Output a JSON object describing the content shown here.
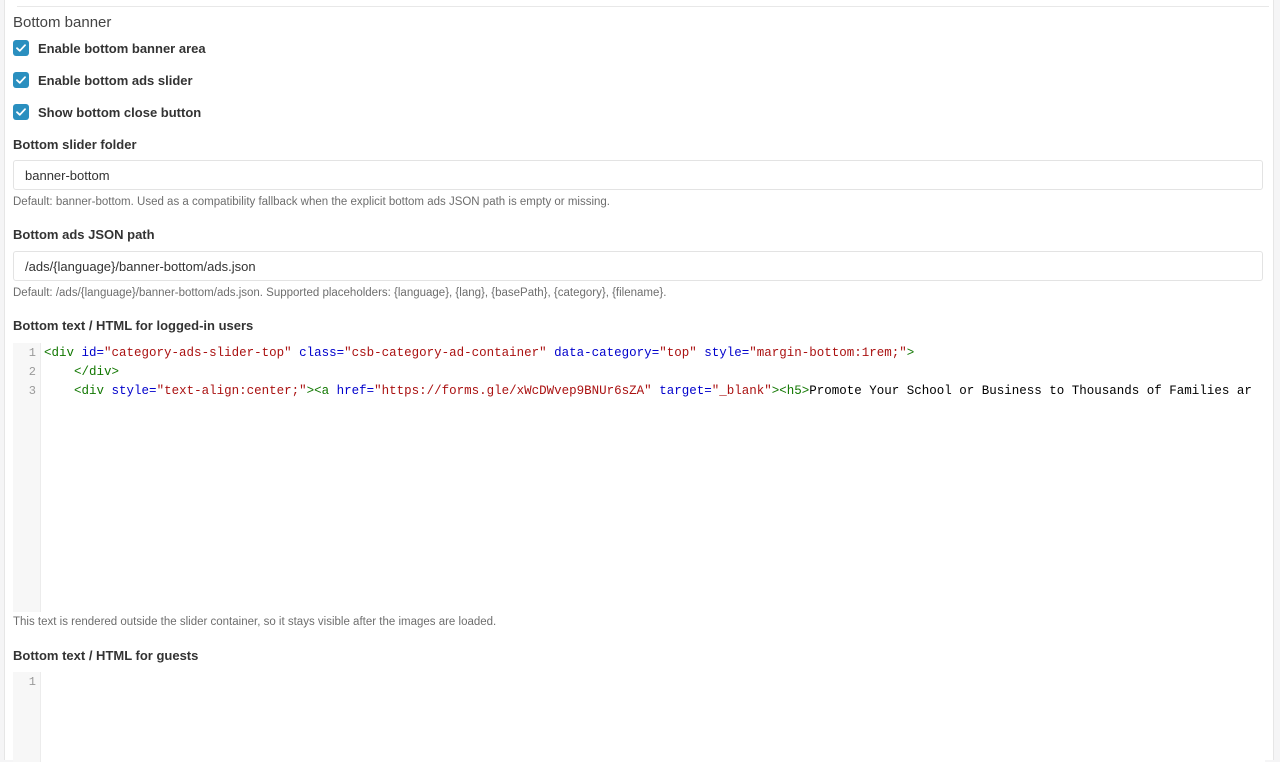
{
  "section": {
    "title": "Bottom banner"
  },
  "checkboxes": [
    {
      "label": "Enable bottom banner area",
      "checked": true
    },
    {
      "label": "Enable bottom ads slider",
      "checked": true
    },
    {
      "label": "Show bottom close button",
      "checked": true
    }
  ],
  "slider_folder": {
    "label": "Bottom slider folder",
    "value": "banner-bottom",
    "help": "Default: banner-bottom. Used as a compatibility fallback when the explicit bottom ads JSON path is empty or missing."
  },
  "ads_json_path": {
    "label": "Bottom ads JSON path",
    "value": "/ads/{language}/banner-bottom/ads.json",
    "help": "Default: /ads/{language}/banner-bottom/ads.json. Supported placeholders: {language}, {lang}, {basePath}, {category}, {filename}."
  },
  "logged_in_editor": {
    "label": "Bottom text / HTML for logged-in users",
    "line_numbers": [
      "1",
      "2",
      "3"
    ],
    "lines": [
      [
        {
          "t": "tag",
          "v": "<div"
        },
        {
          "t": "txt",
          "v": " "
        },
        {
          "t": "attr",
          "v": "id="
        },
        {
          "t": "str",
          "v": "\"category-ads-slider-top\""
        },
        {
          "t": "txt",
          "v": " "
        },
        {
          "t": "attr",
          "v": "class="
        },
        {
          "t": "str",
          "v": "\"csb-category-ad-container\""
        },
        {
          "t": "txt",
          "v": " "
        },
        {
          "t": "attr",
          "v": "data-category="
        },
        {
          "t": "str",
          "v": "\"top\""
        },
        {
          "t": "txt",
          "v": " "
        },
        {
          "t": "attr",
          "v": "style="
        },
        {
          "t": "str",
          "v": "\"margin-bottom:1rem;\""
        },
        {
          "t": "tag",
          "v": ">"
        }
      ],
      [
        {
          "t": "txt",
          "v": "    "
        },
        {
          "t": "tag",
          "v": "</div>"
        }
      ],
      [
        {
          "t": "txt",
          "v": "    "
        },
        {
          "t": "tag",
          "v": "<div"
        },
        {
          "t": "txt",
          "v": " "
        },
        {
          "t": "attr",
          "v": "style="
        },
        {
          "t": "str",
          "v": "\"text-align:center;\""
        },
        {
          "t": "tag",
          "v": "><a"
        },
        {
          "t": "txt",
          "v": " "
        },
        {
          "t": "attr",
          "v": "href="
        },
        {
          "t": "str",
          "v": "\"https://forms.gle/xWcDWvep9BNUr6sZA\""
        },
        {
          "t": "txt",
          "v": " "
        },
        {
          "t": "attr",
          "v": "target="
        },
        {
          "t": "str",
          "v": "\"_blank\""
        },
        {
          "t": "tag",
          "v": "><h5>"
        },
        {
          "t": "txt",
          "v": "Promote Your School or Business to Thousands of Families ar"
        }
      ]
    ],
    "help": "This text is rendered outside the slider container, so it stays visible after the images are loaded."
  },
  "guests_editor": {
    "label": "Bottom text / HTML for guests",
    "line_numbers": [
      "1"
    ]
  },
  "colors": {
    "checkbox": "#2a8fbf",
    "tag": "#117700",
    "attribute": "#0000cc",
    "string": "#aa1111"
  },
  "icons": {
    "checkbox_mark": "check-icon"
  }
}
